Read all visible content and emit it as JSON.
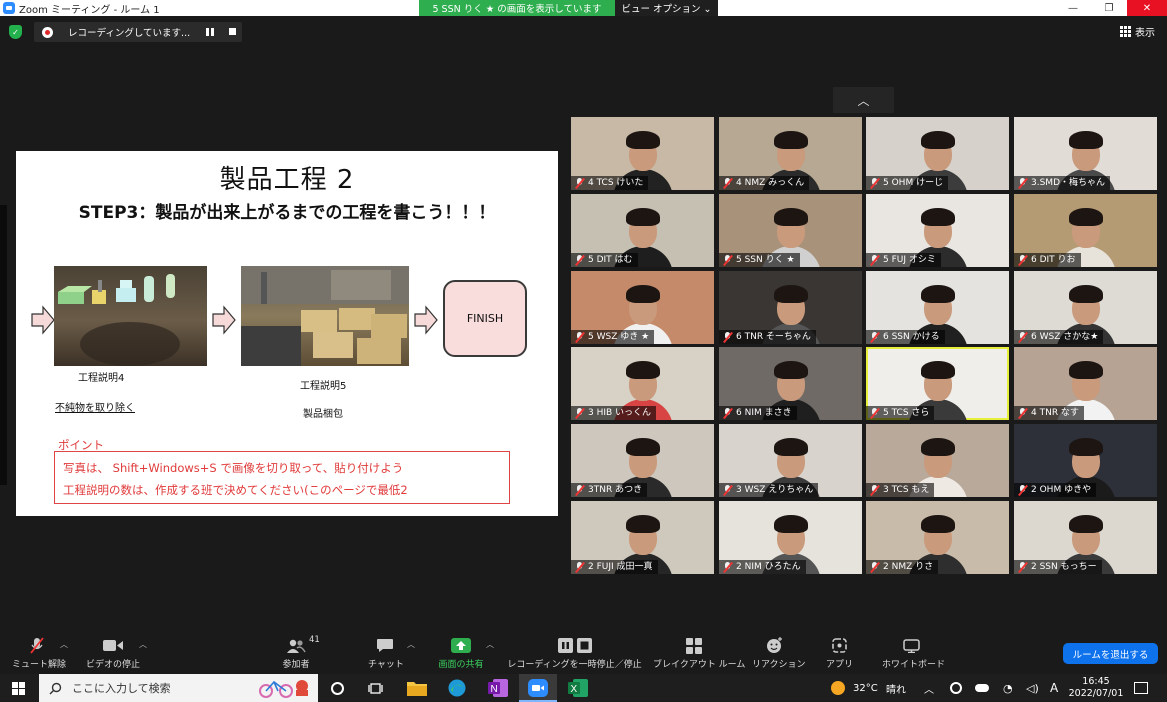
{
  "window": {
    "title": "Zoom ミーティング - ルーム 1"
  },
  "share_banner": "5 SSN りく ★ の画面を表示しています",
  "view_options": "ビュー オプション ⌄",
  "recording": {
    "status": "レコーディングしています..."
  },
  "view_button": "表示",
  "slide": {
    "title": "製品工程 2",
    "subtitle": "STEP3：製品が出来上がるまでの工程を書こう！！！",
    "finish": "FINISH",
    "caption1": "工程説明4",
    "caption1_sub": "不純物を取り除く",
    "caption2": "工程説明5",
    "caption2_sub": "製品梱包",
    "point_label": "ポイント",
    "point_line1": "写真は、 Shift+Windows+S で画像を切り取って、貼り付けよう",
    "point_line2": "工程説明の数は、作成する班で決めてください(このページで最低2"
  },
  "participants": [
    {
      "name": "4 TCS けいた",
      "bg": "#c7b9a6",
      "shirt": "#222222"
    },
    {
      "name": "4 NMZ みっくん",
      "bg": "#b7a893",
      "shirt": "#2b2b2b"
    },
    {
      "name": "5 OHM けーじ",
      "bg": "#d6d2cb",
      "shirt": "#3c3c3c"
    },
    {
      "name": "3.SMD・梅ちゃん",
      "bg": "#e2dcd6",
      "shirt": "#4a4a4a"
    },
    {
      "name": "5 DIT はむ",
      "bg": "#c6c0b2",
      "shirt": "#1e1e1e"
    },
    {
      "name": "5 SSN りく ★",
      "bg": "#a9927a",
      "shirt": "#d0d0d0"
    },
    {
      "name": "5 FUJ オシミ",
      "bg": "#e9e6e1",
      "shirt": "#2c2c2c"
    },
    {
      "name": "6 DIT りお",
      "bg": "#b59b74",
      "shirt": "#e8e3da"
    },
    {
      "name": "5 WSZ ゆき ★",
      "bg": "#c58a6a",
      "shirt": "#f0f0f0"
    },
    {
      "name": "6 TNR そーちゃん",
      "bg": "#3a3633",
      "shirt": "#555555"
    },
    {
      "name": "6 SSN かける",
      "bg": "#e4e3e0",
      "shirt": "#202020"
    },
    {
      "name": "6 WSZ さかな★",
      "bg": "#dedbd5",
      "shirt": "#333333"
    },
    {
      "name": "3 HIB いっくん",
      "bg": "#d7d2c5",
      "shirt": "#d84444"
    },
    {
      "name": "6 NIM まさき",
      "bg": "#6f6a66",
      "shirt": "#1f1f1f"
    },
    {
      "name": "5 TCS さら",
      "bg": "#efeeea",
      "shirt": "#3a3a3a"
    },
    {
      "name": "4 TNR なす",
      "bg": "#b7a394",
      "shirt": "#f2f2f2"
    },
    {
      "name": "3TNR あつき",
      "bg": "#cdc7bd",
      "shirt": "#2a2a2a"
    },
    {
      "name": "3 WSZ えりちゃん",
      "bg": "#d8d3cc",
      "shirt": "#3b3b3b"
    },
    {
      "name": "3 TCS もえ",
      "bg": "#b9a99a",
      "shirt": "#efe9e3"
    },
    {
      "name": "2 OHM ゆきや",
      "bg": "#2d3038",
      "shirt": "#1b1b1b"
    },
    {
      "name": "2 FUJI 成田一真",
      "bg": "#cfc9bd",
      "shirt": "#262626"
    },
    {
      "name": "2 NIM ひろたん",
      "bg": "#e6e3dd",
      "shirt": "#545454"
    },
    {
      "name": "2 NMZ りさ",
      "bg": "#c9bba9",
      "shirt": "#2e2e2e"
    },
    {
      "name": "2 SSN もっちー",
      "bg": "#dcd8d0",
      "shirt": "#3a3a3a"
    }
  ],
  "toolbar": {
    "mute": "ミュート解除",
    "video": "ビデオの停止",
    "participants": "参加者",
    "participant_count": "41",
    "chat": "チャット",
    "share": "画面の共有",
    "recording": "レコーディングを一時停止／停止",
    "breakout": "ブレイクアウト ルーム",
    "reactions": "リアクション",
    "apps": "アプリ",
    "whiteboard": "ホワイトボード",
    "leave": "ルームを退出する"
  },
  "taskbar": {
    "search_placeholder": "ここに入力して検索",
    "temperature": "32°C",
    "weather": "晴れ",
    "ime": "A",
    "time": "16:45",
    "date": "2022/07/01"
  },
  "colors": {
    "zoom_blue": "#0e72ed",
    "share_green": "#2eae4e",
    "active_speaker": "#e6ef3a",
    "mute_red": "#e33333"
  }
}
